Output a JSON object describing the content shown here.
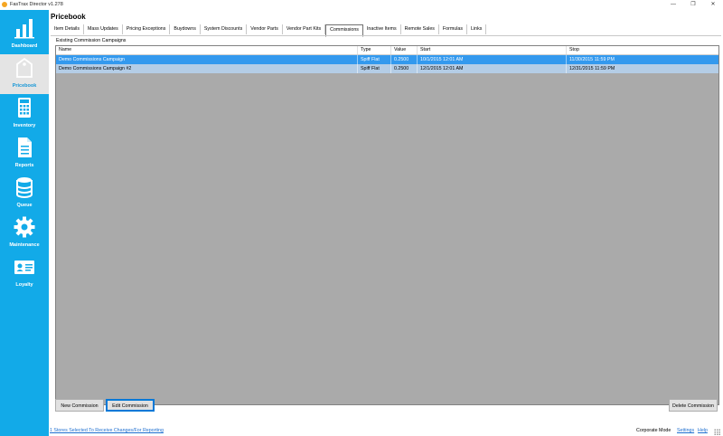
{
  "window": {
    "title": "FasTrax Director v1.278",
    "min_glyph": "—",
    "restore_glyph": "❐",
    "close_glyph": "✕"
  },
  "sidebar": {
    "items": [
      {
        "label": "Dashboard",
        "icon": "bar-chart-icon",
        "active": false
      },
      {
        "label": "Pricebook",
        "icon": "tag-icon",
        "active": true
      },
      {
        "label": "Inventory",
        "icon": "calculator-icon",
        "active": false
      },
      {
        "label": "Reports",
        "icon": "document-icon",
        "active": false
      },
      {
        "label": "Queue",
        "icon": "database-icon",
        "active": false
      },
      {
        "label": "Maintenance",
        "icon": "gear-icon",
        "active": false
      },
      {
        "label": "Loyalty",
        "icon": "id-card-icon",
        "active": false
      }
    ]
  },
  "page": {
    "title": "Pricebook"
  },
  "tabs": [
    {
      "label": "Item Details"
    },
    {
      "label": "Mass Updates"
    },
    {
      "label": "Pricing Exceptions"
    },
    {
      "label": "Buydowns"
    },
    {
      "label": "System Discounts"
    },
    {
      "label": "Vendor Parts"
    },
    {
      "label": "Vendor Part Kits"
    },
    {
      "label": "Commissions",
      "active": true
    },
    {
      "label": "Inactive Items"
    },
    {
      "label": "Remote Sales"
    },
    {
      "label": "Formulas"
    },
    {
      "label": "Links"
    }
  ],
  "group_label": "Existing Commission Campaigns",
  "grid": {
    "columns": [
      "Name",
      "Type",
      "Value",
      "Start",
      "Stop"
    ],
    "rows": [
      [
        "Demo Commissions Campaign",
        "Spiff Flat",
        "0.2500",
        "10/1/2015 12:01 AM",
        "11/30/2015 11:59 PM"
      ],
      [
        "Demo Commissions Campaign #2",
        "Spiff Flat",
        "0.2500",
        "12/1/2015 12:01 AM",
        "12/31/2015 11:59 PM"
      ]
    ]
  },
  "buttons": {
    "new": "New Commission",
    "edit": "Edit Commission",
    "delete": "Delete Commission"
  },
  "footer": {
    "stores_link": "1 Stores Selected To Receive Changes/For Reporting",
    "mode": "Corporate Mode",
    "settings": "Settings",
    "help": "Help"
  },
  "colors": {
    "sidebar": "#12aae8",
    "selected_row": "#3399ee",
    "secondary_row": "#b4cde6",
    "grid_bg": "#aaaaaa"
  }
}
